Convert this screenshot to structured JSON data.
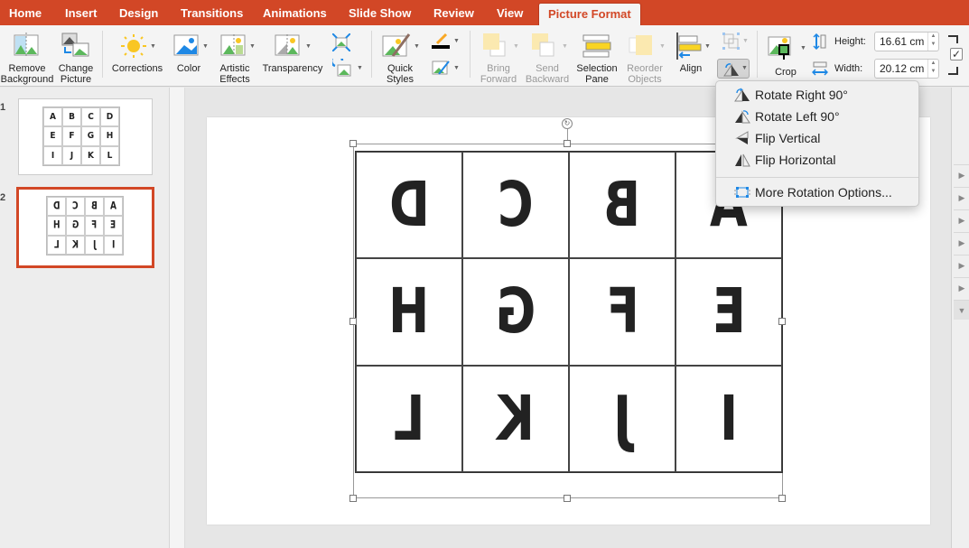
{
  "tabs": [
    "Home",
    "Insert",
    "Design",
    "Transitions",
    "Animations",
    "Slide Show",
    "Review",
    "View",
    "Picture Format"
  ],
  "active_tab": "Picture Format",
  "ribbon": {
    "remove_bg": [
      "Remove",
      "Background"
    ],
    "change_pic": [
      "Change",
      "Picture"
    ],
    "corrections": "Corrections",
    "color": "Color",
    "artistic": [
      "Artistic",
      "Effects"
    ],
    "transparency": "Transparency",
    "quick_styles": [
      "Quick",
      "Styles"
    ],
    "bring_forward": [
      "Bring",
      "Forward"
    ],
    "send_backward": [
      "Send",
      "Backward"
    ],
    "selection_pane": [
      "Selection",
      "Pane"
    ],
    "reorder": [
      "Reorder",
      "Objects"
    ],
    "align": "Align",
    "crop": "Crop",
    "height_label": "Height:",
    "height_value": "16.61 cm",
    "width_label": "Width:",
    "width_value": "20.12 cm"
  },
  "rotate_menu": {
    "items": [
      "Rotate Right 90°",
      "Rotate Left 90°",
      "Flip Vertical",
      "Flip Horizontal"
    ],
    "more": "More Rotation Options..."
  },
  "slides": [
    {
      "number": "1",
      "letters": [
        "A",
        "B",
        "C",
        "D",
        "E",
        "F",
        "G",
        "H",
        "I",
        "J",
        "K",
        "L"
      ],
      "selected": false
    },
    {
      "number": "2",
      "letters": [
        "D",
        "C",
        "B",
        "A",
        "H",
        "G",
        "F",
        "E",
        "L",
        "K",
        "J",
        "I"
      ],
      "selected": true,
      "mirrored": true
    }
  ],
  "canvas_letters": [
    "D",
    "C",
    "B",
    "A",
    "H",
    "G",
    "F",
    "E",
    "L",
    "K",
    "J",
    "I"
  ],
  "colors": {
    "accent": "#d24726",
    "menu_bg": "#f0f0f0",
    "ribbon_bg": "#f4f4f4"
  }
}
